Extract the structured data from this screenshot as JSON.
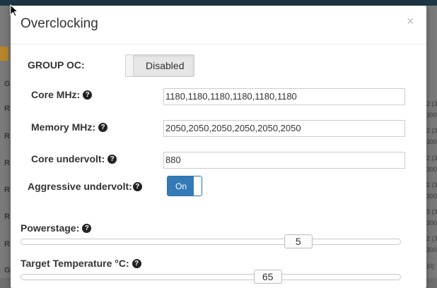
{
  "modal": {
    "title": "Overclocking",
    "close_glyph": "×"
  },
  "group_oc": {
    "label": "GROUP OC:",
    "toggle_state": "Disabled"
  },
  "core_mhz": {
    "label": "Core MHz:",
    "help_icon": "question-circle-icon",
    "value": "1180,1180,1180,1180,1180,1180"
  },
  "memory_mhz": {
    "label": "Memory MHz:",
    "help_icon": "question-circle-icon",
    "value": "2050,2050,2050,2050,2050,2050"
  },
  "core_undervolt": {
    "label": "Core undervolt:",
    "help_icon": "question-circle-icon",
    "value": "880"
  },
  "aggressive_undervolt": {
    "label": "Aggressive undervolt:",
    "help_icon": "question-circle-icon",
    "toggle_state": "On"
  },
  "powerstage": {
    "label": "Powerstage:",
    "help_icon": "question-circle-icon",
    "value": "5",
    "fraction": 0.73
  },
  "target_temperature": {
    "label": "Target Temperature °C:",
    "help_icon": "question-circle-icon",
    "value": "65",
    "fraction": 0.65
  },
  "background": {
    "left_labels": [
      "G",
      "R",
      "R",
      "R",
      "R",
      "R",
      "R",
      "G"
    ],
    "right_labels": [
      "2 (3",
      "300",
      "2 (3",
      "300",
      "2 (3",
      "300",
      "2 (3",
      "300",
      "3 (3",
      "300",
      "2 (3",
      "300",
      ")0)"
    ]
  },
  "colors": {
    "accent": "#337ab7",
    "topbar": "#1f3644"
  }
}
